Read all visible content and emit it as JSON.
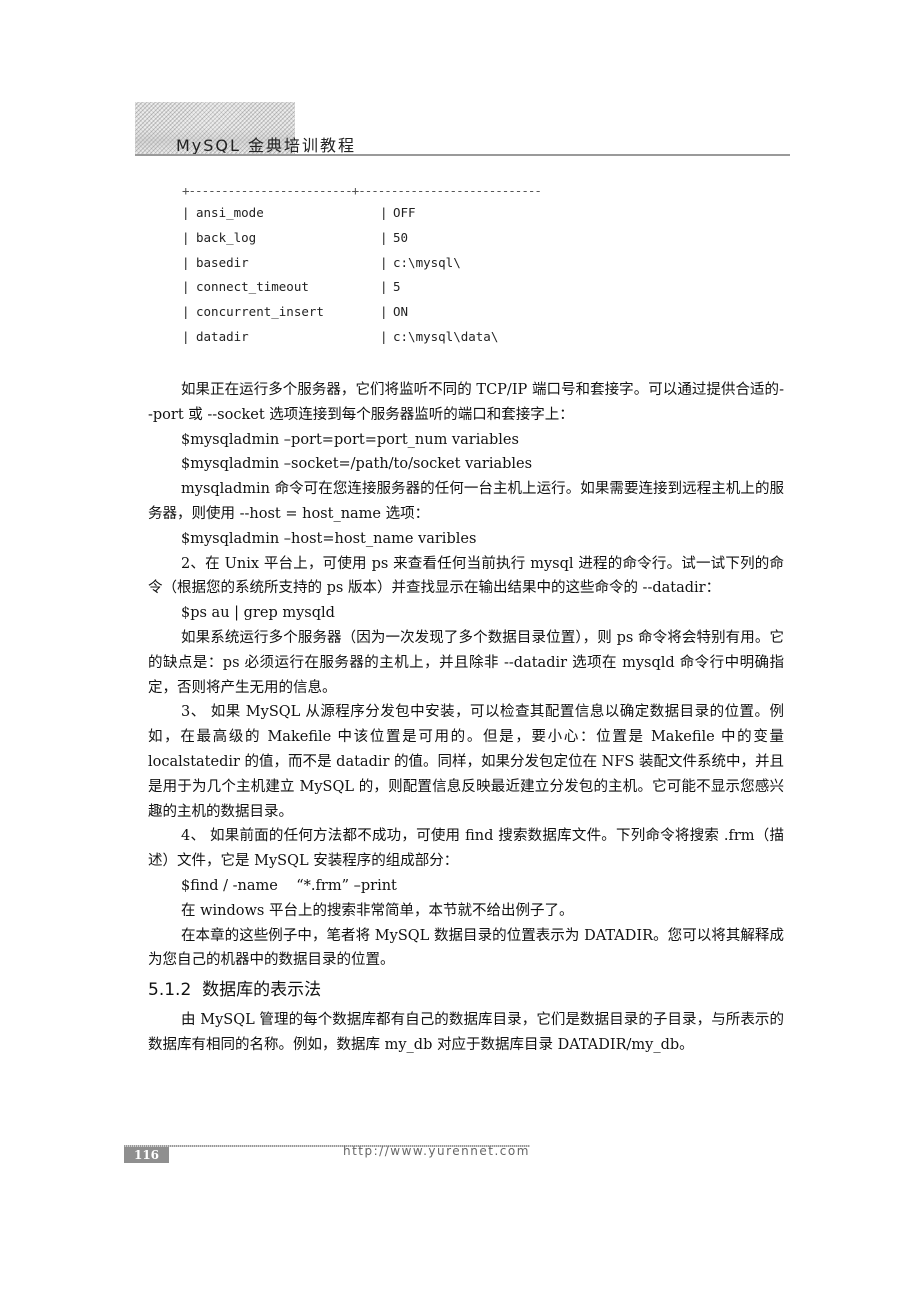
{
  "header": {
    "book_title": "MySQL 金典培训教程"
  },
  "code_table": {
    "separator": "+-------------------------+----------------------------",
    "rows": [
      {
        "key": "ansi_mode",
        "value": "OFF"
      },
      {
        "key": "back_log",
        "value": "50"
      },
      {
        "key": "basedir",
        "value": "c:\\mysql\\"
      },
      {
        "key": "connect_timeout",
        "value": "5"
      },
      {
        "key": "concurrent_insert",
        "value": "ON"
      },
      {
        "key": "datadir",
        "value": "c:\\mysql\\data\\"
      }
    ]
  },
  "body": {
    "p1": "如果正在运行多个服务器，它们将监听不同的 TCP/IP 端口号和套接字。可以通过提供合适的--port 或 --socket 选项连接到每个服务器监听的端口和套接字上：",
    "cmd1": "$mysqladmin –port=port=port_num variables",
    "cmd2": "$mysqladmin –socket=/path/to/socket variables",
    "p2": "mysqladmin 命令可在您连接服务器的任何一台主机上运行。如果需要连接到远程主机上的服务器，则使用 --host = host_name 选项：",
    "cmd3": "$mysqladmin –host=host_name varibles",
    "p3": "2、在 Unix 平台上，可使用 ps 来查看任何当前执行 mysql 进程的命令行。试一试下列的命令（根据您的系统所支持的 ps 版本）并查找显示在输出结果中的这些命令的 --datadir：",
    "cmd4": "$ps au | grep mysqld",
    "p4": "如果系统运行多个服务器（因为一次发现了多个数据目录位置），则 ps 命令将会特别有用。它的缺点是：ps 必须运行在服务器的主机上，并且除非 --datadir 选项在 mysqld 命令行中明确指定，否则将产生无用的信息。",
    "p5": "3、 如果 MySQL 从源程序分发包中安装，可以检查其配置信息以确定数据目录的位置。例如，在最高级的 Makefile 中该位置是可用的。但是，要小心：位置是 Makefile 中的变量 localstatedir 的值，而不是 datadir 的值。同样，如果分发包定位在 NFS 装配文件系统中，并且是用于为几个主机建立 MySQL 的，则配置信息反映最近建立分发包的主机。它可能不显示您感兴趣的主机的数据目录。",
    "p6": "4、 如果前面的任何方法都不成功，可使用 find 搜索数据库文件。下列命令将搜索 .frm（描述）文件，它是 MySQL 安装程序的组成部分：",
    "cmd5": "$find / -name    “*.frm” –print",
    "p7": "在 windows 平台上的搜索非常简单，本节就不给出例子了。",
    "p8": "在本章的这些例子中，笔者将 MySQL 数据目录的位置表示为 DATADIR。您可以将其解释成为您自己的机器中的数据目录的位置。",
    "section_heading": "5.1.2  数据库的表示法",
    "p9": "由 MySQL 管理的每个数据库都有自己的数据库目录，它们是数据目录的子目录，与所表示的数据库有相同的名称。例如，数据库 my_db 对应于数据库目录 DATADIR/my_db。"
  },
  "footer": {
    "page_number": "116",
    "url": "http://www.yurennet.com"
  }
}
